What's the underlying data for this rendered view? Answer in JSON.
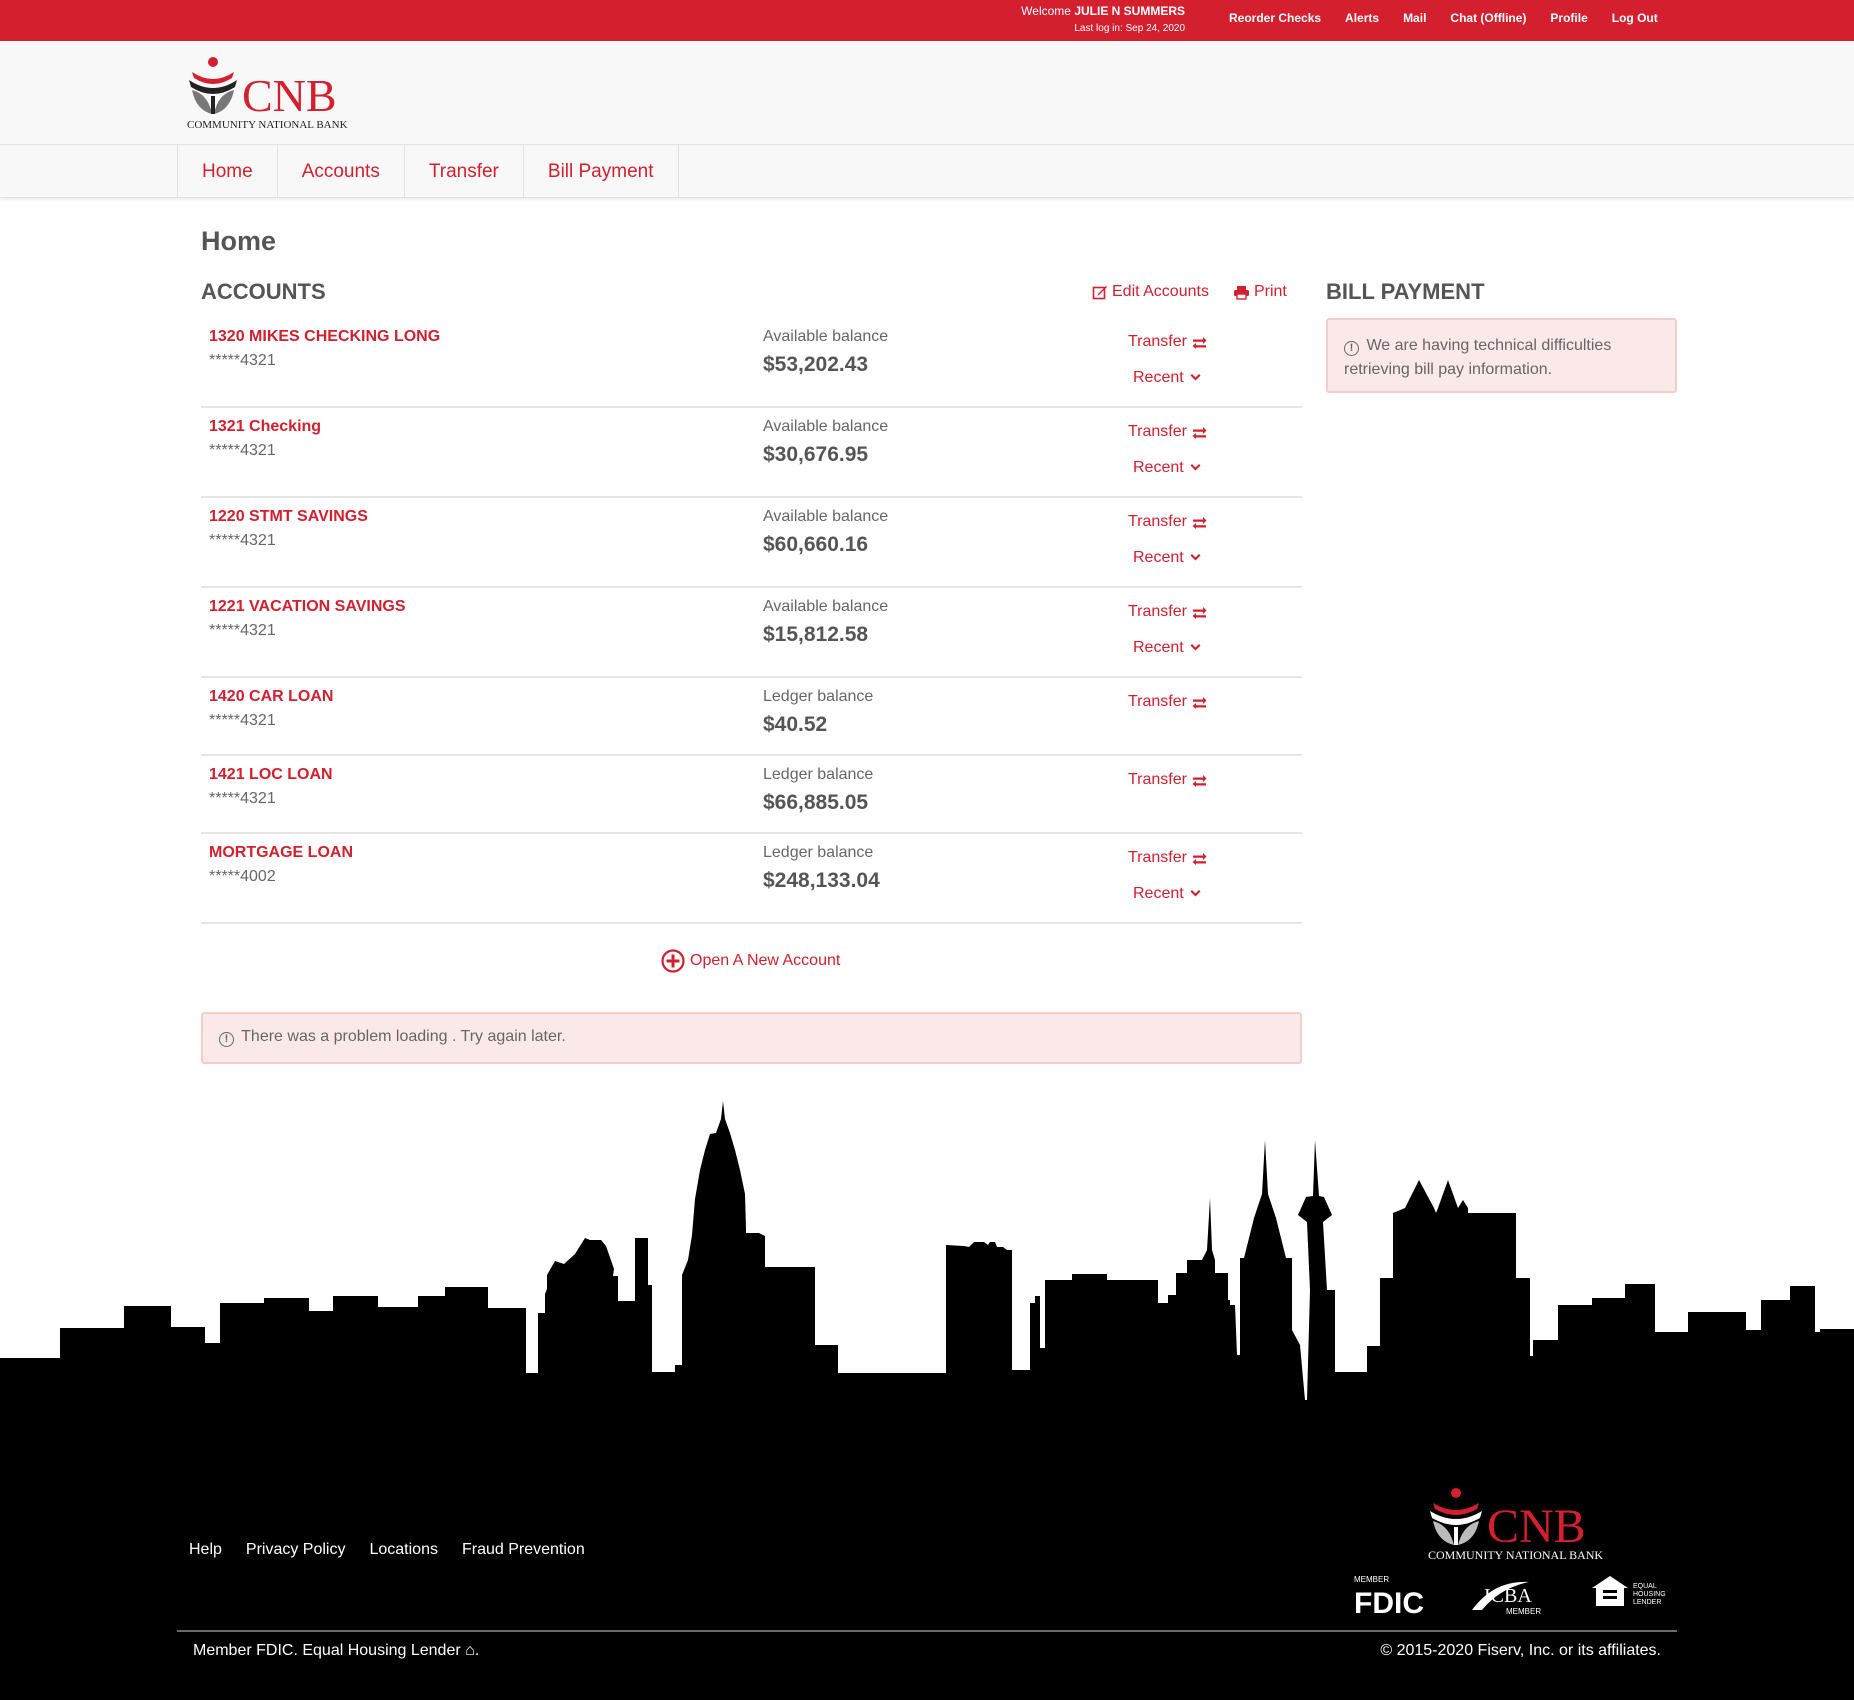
{
  "topbar": {
    "welcome_prefix": "Welcome",
    "user_name": "JULIE N SUMMERS",
    "last_login": "Last log in: Sep 24, 2020",
    "links": [
      "Reorder Checks",
      "Alerts",
      "Mail",
      "Chat (Offline)",
      "Profile",
      "Log Out"
    ]
  },
  "brand": {
    "name": "CNB",
    "tagline": "COMMUNITY NATIONAL BANK",
    "primary_color": "#d31f2e"
  },
  "nav": {
    "items": [
      "Home",
      "Accounts",
      "Transfer",
      "Bill Payment"
    ]
  },
  "page": {
    "title": "Home"
  },
  "accounts": {
    "heading": "ACCOUNTS",
    "edit_label": "Edit Accounts",
    "print_label": "Print",
    "transfer_label": "Transfer",
    "recent_label": "Recent",
    "rows": [
      {
        "name": "1320 MIKES CHECKING LONG",
        "mask": "*****4321",
        "balance_label": "Available balance",
        "balance": "$53,202.43",
        "has_recent": true
      },
      {
        "name": "1321 Checking",
        "mask": "*****4321",
        "balance_label": "Available balance",
        "balance": "$30,676.95",
        "has_recent": true
      },
      {
        "name": "1220 STMT SAVINGS",
        "mask": "*****4321",
        "balance_label": "Available balance",
        "balance": "$60,660.16",
        "has_recent": true
      },
      {
        "name": "1221 VACATION SAVINGS",
        "mask": "*****4321",
        "balance_label": "Available balance",
        "balance": "$15,812.58",
        "has_recent": true
      },
      {
        "name": "1420 CAR LOAN",
        "mask": "*****4321",
        "balance_label": "Ledger balance",
        "balance": "$40.52",
        "has_recent": false
      },
      {
        "name": "1421 LOC LOAN",
        "mask": "*****4321",
        "balance_label": "Ledger balance",
        "balance": "$66,885.05",
        "has_recent": false
      },
      {
        "name": "MORTGAGE LOAN",
        "mask": "*****4002",
        "balance_label": "Ledger balance",
        "balance": "$248,133.04",
        "has_recent": true
      }
    ],
    "open_new_label": "Open A New Account",
    "load_error": "There was a problem loading . Try again later."
  },
  "bill_payment": {
    "heading": "BILL PAYMENT",
    "error": "We are having technical difficulties retrieving bill pay information."
  },
  "footer": {
    "links": [
      "Help",
      "Privacy Policy",
      "Locations",
      "Fraud Prevention"
    ],
    "badges": {
      "fdic_member": "MEMBER",
      "fdic": "FDIC",
      "icba": "ICBA",
      "icba_member": "MEMBER",
      "ehl": "EQUAL HOUSING LENDER"
    },
    "left_text": "Member FDIC. Equal Housing Lender",
    "copyright": "© 2015-2020 Fiserv, Inc. or its affiliates."
  }
}
